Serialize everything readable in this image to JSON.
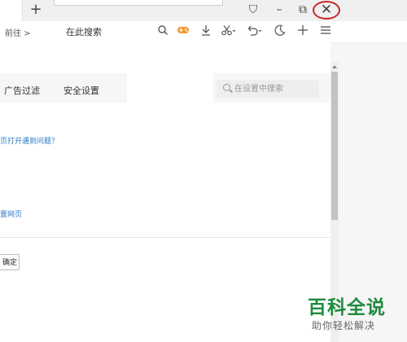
{
  "titlebar": {
    "new_tab": "+",
    "icons": {
      "skin": "tshirt-icon",
      "minimize": "minimize-icon",
      "restore": "restore-icon",
      "close": "close-icon"
    },
    "glyphs": {
      "skin": "⛉",
      "minimize": "–",
      "restore": "⧉",
      "close": "✕"
    },
    "highlight_color": "#c62828"
  },
  "toolbar": {
    "forward_label": "前往 >",
    "search_label": "在此搜索",
    "icons": [
      "search-icon",
      "game-icon",
      "download-icon",
      "cut-icon",
      "undo-icon",
      "night-mode-icon",
      "add-icon",
      "menu-icon"
    ]
  },
  "settings": {
    "tabs": [
      "广告过滤",
      "安全设置"
    ],
    "search_placeholder": "在设置中搜索",
    "link_help": "页打开遇到问题？",
    "link_webpage": "置网页",
    "confirm_button": "确定"
  },
  "watermark": {
    "title": "百科全说",
    "subtitle": "助你轻松解决",
    "color": "#1e8c3e"
  }
}
